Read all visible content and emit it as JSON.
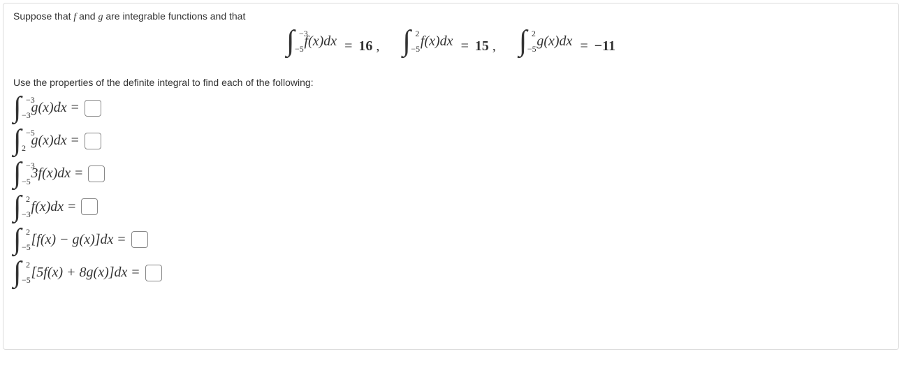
{
  "prompt": {
    "pre": "Suppose that ",
    "f": "f",
    "mid": " and ",
    "g": "g",
    "post": " are integrable functions and that"
  },
  "given": [
    {
      "lb": "−5",
      "ub": "−3",
      "fn": "f(x)dx",
      "val": "16"
    },
    {
      "lb": "−5",
      "ub": "2",
      "fn": "f(x)dx",
      "val": "15"
    },
    {
      "lb": "−5",
      "ub": "2",
      "fn": "g(x)dx",
      "val": "−11"
    }
  ],
  "instruction": "Use the properties of the definite integral to find each of the following:",
  "questions": [
    {
      "lb": "−3",
      "ub": "−3",
      "body": "g(x)dx"
    },
    {
      "lb": "2",
      "ub": "−5",
      "body": "g(x)dx"
    },
    {
      "lb": "−5",
      "ub": "−3",
      "body": "3f(x)dx"
    },
    {
      "lb": "−3",
      "ub": "2",
      "body": "f(x)dx"
    },
    {
      "lb": "−5",
      "ub": "2",
      "body": "[f(x) − g(x)]dx"
    },
    {
      "lb": "−5",
      "ub": "2",
      "body": "[5f(x) + 8g(x)]dx"
    }
  ]
}
